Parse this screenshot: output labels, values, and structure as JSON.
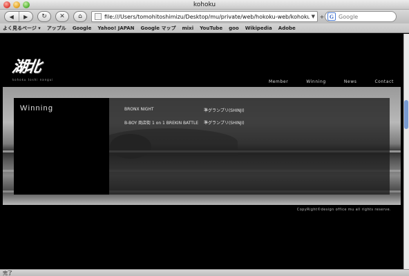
{
  "window": {
    "title": "kohoku"
  },
  "toolbar": {
    "back_icon": "◀",
    "forward_icon": "▶",
    "reload_icon": "↻",
    "stop_icon": "✕",
    "home_icon": "⌂",
    "add_icon": "+",
    "url": "file:///Users/tomohitoshimizu/Desktop/mu/private/web/hokoku-web/kohoku.html",
    "search_placeholder": "Google",
    "search_engine_letter": "G"
  },
  "bookmarks": [
    "よく見るページ ▾",
    "アップル",
    "Google",
    "Yahoo! JAPAN",
    "Google マップ",
    "mixi",
    "YouTube",
    "goo",
    "Wikipedia",
    "Adobe"
  ],
  "site": {
    "logo_text": "湖北",
    "logo_sub": "kohoku  toshi  nangui",
    "nav": [
      "Member",
      "Winning",
      "News",
      "Contact"
    ],
    "section_heading": "Winning",
    "wins": [
      {
        "event": "BRONX NIGHT",
        "result": "準グランプリ(SHINJI)"
      },
      {
        "event": "B-BOY 商店街  1 on 1 BREKIN BATTLE",
        "result": "準グランプリ(SHINJI)"
      }
    ],
    "copyright": "CopyRight©design office mu all rights reserve."
  },
  "status": {
    "text": "完了"
  }
}
